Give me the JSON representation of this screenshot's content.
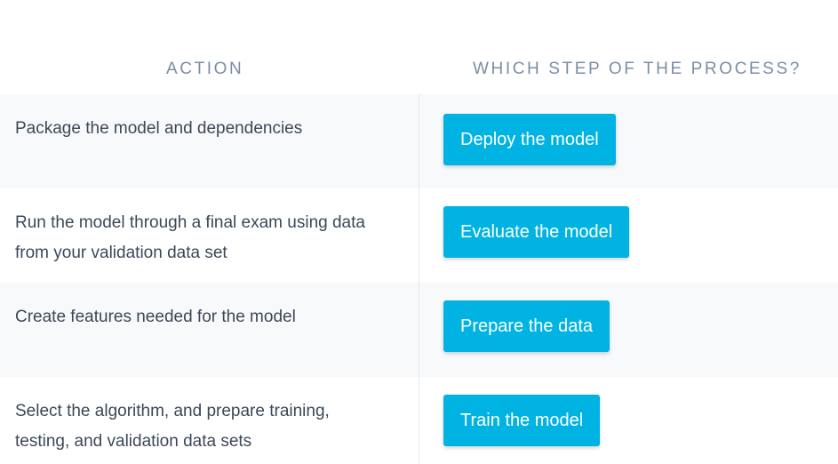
{
  "header": {
    "action": "ACTION",
    "step": "WHICH STEP OF THE PROCESS?"
  },
  "rows": [
    {
      "action": "Package the model and dependencies",
      "step": "Deploy the model"
    },
    {
      "action": "Run the model through a final exam using data from your validation data set",
      "step": "Evaluate the model"
    },
    {
      "action": "Create features needed for the model",
      "step": "Prepare the data"
    },
    {
      "action": "Select the algorithm, and prepare training, testing, and validation data sets",
      "step": "Train the model"
    }
  ],
  "colors": {
    "button_background": "#00b3e3",
    "header_text": "#7b8ea6",
    "body_text": "#3c4858",
    "shaded_row": "#f8f9fb"
  }
}
